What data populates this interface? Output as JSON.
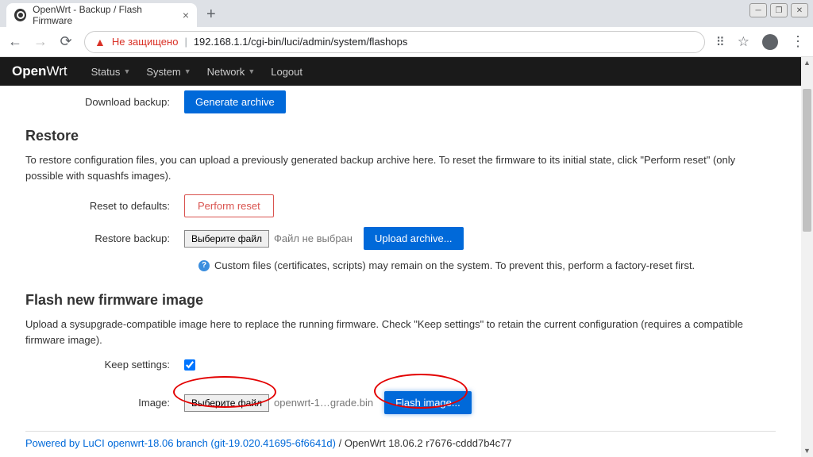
{
  "browser": {
    "tab_title": "OpenWrt - Backup / Flash Firmware",
    "not_secure": "Не защищено",
    "url": "192.168.1.1/cgi-bin/luci/admin/system/flashops"
  },
  "nav": {
    "logo_open": "Open",
    "logo_wrt": "Wrt",
    "status": "Status",
    "system": "System",
    "network": "Network",
    "logout": "Logout"
  },
  "backup": {
    "download_label": "Download backup:",
    "generate_btn": "Generate archive"
  },
  "restore": {
    "heading": "Restore",
    "desc": "To restore configuration files, you can upload a previously generated backup archive here. To reset the firmware to its initial state, click \"Perform reset\" (only possible with squashfs images).",
    "reset_label": "Reset to defaults:",
    "reset_btn": "Perform reset",
    "restore_label": "Restore backup:",
    "choose_file": "Выберите файл",
    "no_file": "Файл не выбран",
    "upload_btn": "Upload archive...",
    "hint": "Custom files (certificates, scripts) may remain on the system. To prevent this, perform a factory-reset first."
  },
  "flash": {
    "heading": "Flash new firmware image",
    "desc": "Upload a sysupgrade-compatible image here to replace the running firmware. Check \"Keep settings\" to retain the current configuration (requires a compatible firmware image).",
    "keep_label": "Keep settings:",
    "image_label": "Image:",
    "choose_file": "Выберите файл",
    "filename": "openwrt-1…grade.bin",
    "flash_btn": "Flash image..."
  },
  "footer": {
    "link": "Powered by LuCI openwrt-18.06 branch (git-19.020.41695-6f6641d)",
    "version": " / OpenWrt 18.06.2 r7676-cddd7b4c77"
  }
}
